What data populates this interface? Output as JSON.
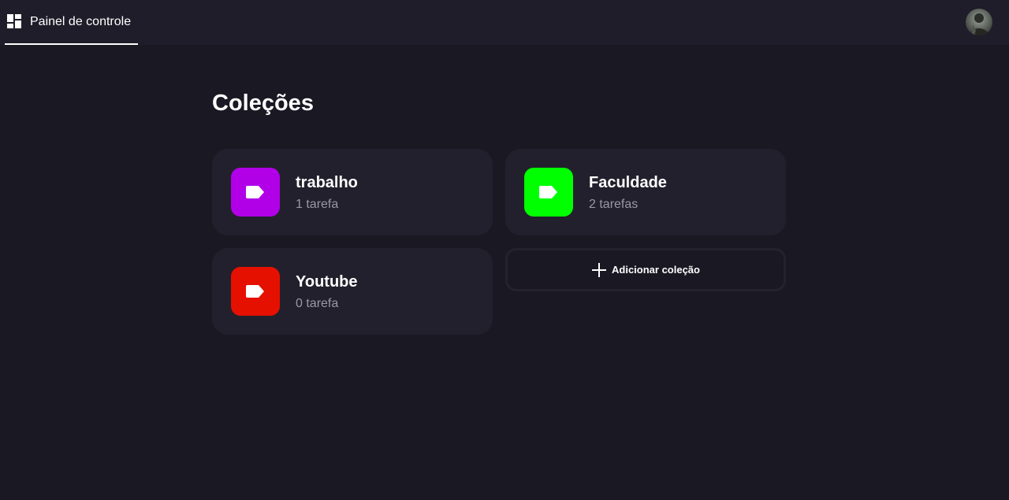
{
  "header": {
    "nav_label": "Painel de controle",
    "nav_icon": "dashboard-icon",
    "avatar_icon": "user-avatar"
  },
  "main": {
    "title": "Coleções",
    "collections": [
      {
        "name": "trabalho",
        "count": "1 tarefa",
        "color": "#b100e8",
        "icon": "tag-icon"
      },
      {
        "name": "Faculdade",
        "count": "2 tarefas",
        "color": "#00ff00",
        "icon": "tag-icon"
      },
      {
        "name": "Youtube",
        "count": "0 tarefa",
        "color": "#e51000",
        "icon": "tag-icon"
      }
    ],
    "add_label": "Adicionar coleção",
    "add_icon": "plus-icon"
  },
  "colors": {
    "background": "#1a1823",
    "card": "#22202c",
    "topbar": "#1f1d29"
  }
}
